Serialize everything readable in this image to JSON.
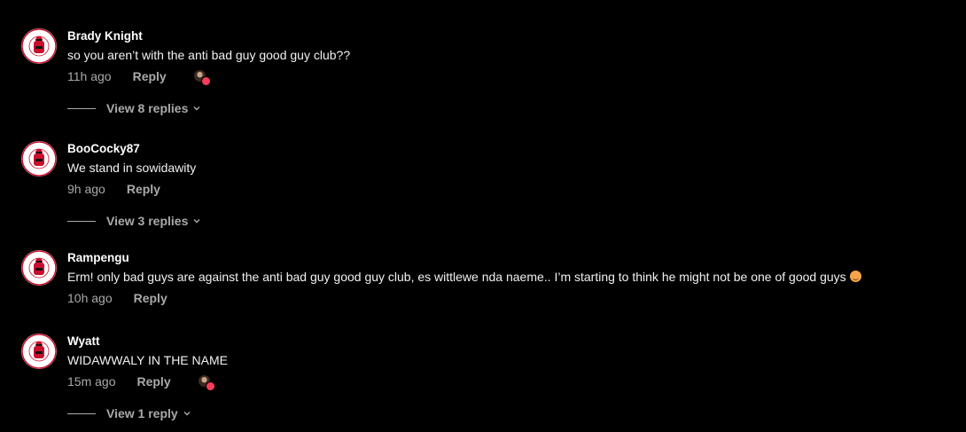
{
  "comments": [
    {
      "username": "Brady Knight",
      "text": "so you aren’t with the anti bad guy good guy club??",
      "time": "11h ago",
      "reply_label": "Reply",
      "creator_heart": true,
      "view_replies": "View 8 replies"
    },
    {
      "username": "BooCocky87",
      "text": "We stand in sowidawity",
      "time": "9h ago",
      "reply_label": "Reply",
      "creator_heart": false,
      "view_replies": "View 3 replies"
    },
    {
      "username": "Rampengu",
      "text": "Erm! only bad guys are against the anti bad guy good guy club, es wittlewe nda naeme.. I’m starting to think he might not be one of good guys",
      "time": "10h ago",
      "reply_label": "Reply",
      "creator_heart": false,
      "view_replies": ""
    },
    {
      "username": "Wyatt",
      "text": "WIDAWWALY IN THE NAME",
      "time": "15m ago",
      "reply_label": "Reply",
      "creator_heart": true,
      "view_replies": "View 1 reply"
    }
  ],
  "icons": {
    "avatar": "anti-bad-guy-club-logo",
    "creator_heart": "creator-heart-icon",
    "chevron": "chevron-down-icon",
    "emoji": "pouting-face-emoji"
  },
  "colors": {
    "background": "#000000",
    "text": "#f1f1f1",
    "secondary": "#aaaaaa",
    "heart": "#ff3b5c",
    "logo_red": "#c8102e"
  }
}
